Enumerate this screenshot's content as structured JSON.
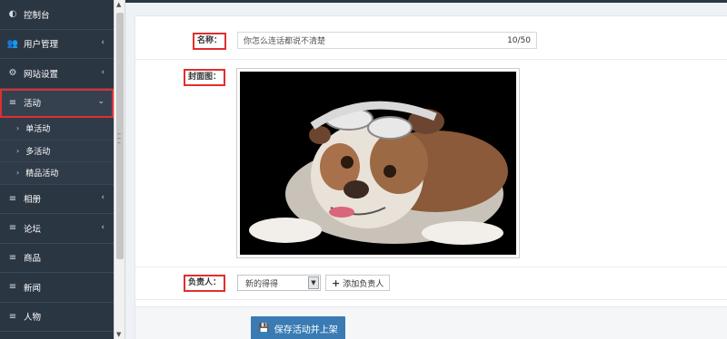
{
  "sidebar": {
    "items": [
      {
        "icon": "dashboard-icon",
        "glyph": "◐",
        "label": "控制台",
        "has_chevron": false
      },
      {
        "icon": "users-icon",
        "glyph": "👥",
        "label": "用户管理",
        "has_chevron": true
      },
      {
        "icon": "cogs-icon",
        "glyph": "⚙",
        "label": "网站设置",
        "has_chevron": true
      },
      {
        "icon": "list-icon",
        "glyph": "≡",
        "label": "活动",
        "has_chevron": true,
        "expanded": true
      },
      {
        "icon": "list-icon",
        "glyph": "≡",
        "label": "相册",
        "has_chevron": true
      },
      {
        "icon": "list-icon",
        "glyph": "≡",
        "label": "论坛",
        "has_chevron": true
      },
      {
        "icon": "list-icon",
        "glyph": "≡",
        "label": "商品",
        "has_chevron": false
      },
      {
        "icon": "list-icon",
        "glyph": "≡",
        "label": "新闻",
        "has_chevron": false
      },
      {
        "icon": "list-icon",
        "glyph": "≡",
        "label": "人物",
        "has_chevron": false
      }
    ],
    "sub_items": [
      "单活动",
      "多活动",
      "精品活动"
    ],
    "chevron_left": "‹",
    "chevron_down": "⌄",
    "sub_arrow": "›"
  },
  "form": {
    "name_label": "名称：",
    "name_value": "你怎么连话都说不清楚",
    "name_counter": "10/50",
    "cover_label": "封面图：",
    "owner_label": "负责人：",
    "owner_selected": "新的得得",
    "add_owner_label": "添加负责人",
    "save_label": "保存活动并上架"
  },
  "colors": {
    "sidebar_bg": "#2b3643",
    "highlight": "#e02f2f",
    "primary_button": "#3a7bb3"
  }
}
